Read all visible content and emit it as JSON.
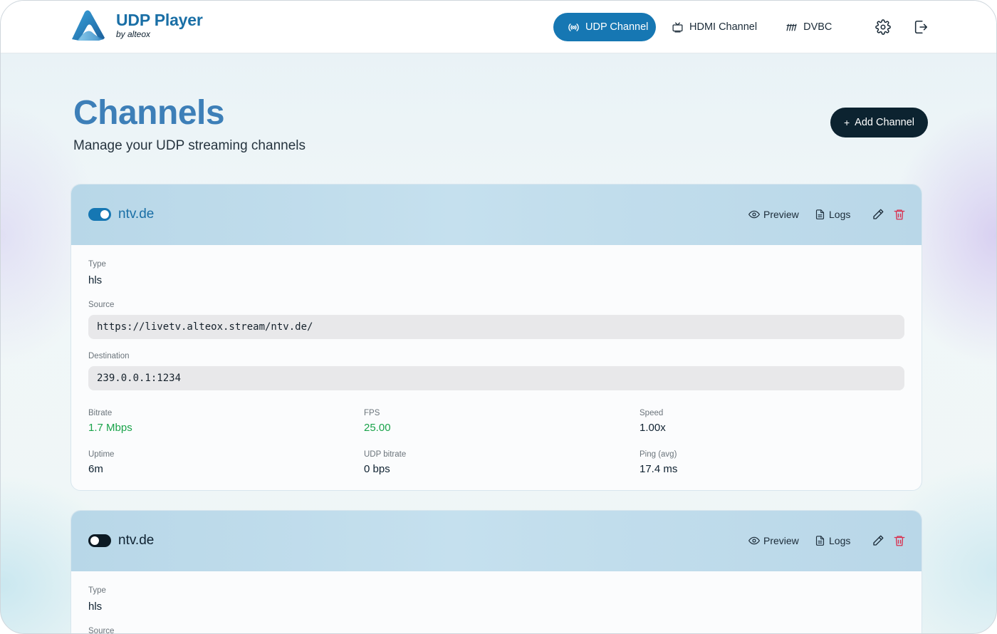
{
  "app": {
    "name": "UDP Player",
    "byline": "by alteox"
  },
  "nav": {
    "items": [
      {
        "label": "UDP Channel",
        "icon": "broadcast-icon",
        "active": true
      },
      {
        "label": "HDMI Channel",
        "icon": "tv-icon",
        "active": false
      },
      {
        "label": "DVBC",
        "icon": "signal-bars-icon",
        "active": false
      }
    ],
    "settings_icon": "gear-icon",
    "logout_icon": "logout-icon"
  },
  "page": {
    "title": "Channels",
    "subtitle": "Manage your UDP streaming channels",
    "add_button": "Add Channel",
    "add_button_icon": "+"
  },
  "labels": {
    "type": "Type",
    "source": "Source",
    "destination": "Destination",
    "bitrate": "Bitrate",
    "fps": "FPS",
    "speed": "Speed",
    "uptime": "Uptime",
    "udp_bitrate": "UDP bitrate",
    "ping": "Ping (avg)",
    "preview": "Preview",
    "logs": "Logs"
  },
  "channels": [
    {
      "name": "ntv.de",
      "enabled": true,
      "type": "hls",
      "source": "https://livetv.alteox.stream/ntv.de/",
      "destination": "239.0.0.1:1234",
      "bitrate": "1.7 Mbps",
      "fps": "25.00",
      "speed": "1.00x",
      "uptime": "6m",
      "udp_bitrate": "0 bps",
      "ping": "17.4 ms"
    },
    {
      "name": "ntv.de",
      "enabled": false,
      "type": "hls"
    }
  ],
  "colors": {
    "accent": "#1677b3",
    "title": "#3d7fb8",
    "dark_button": "#0c2330",
    "green": "#19a34a",
    "delete": "#d9304f"
  }
}
